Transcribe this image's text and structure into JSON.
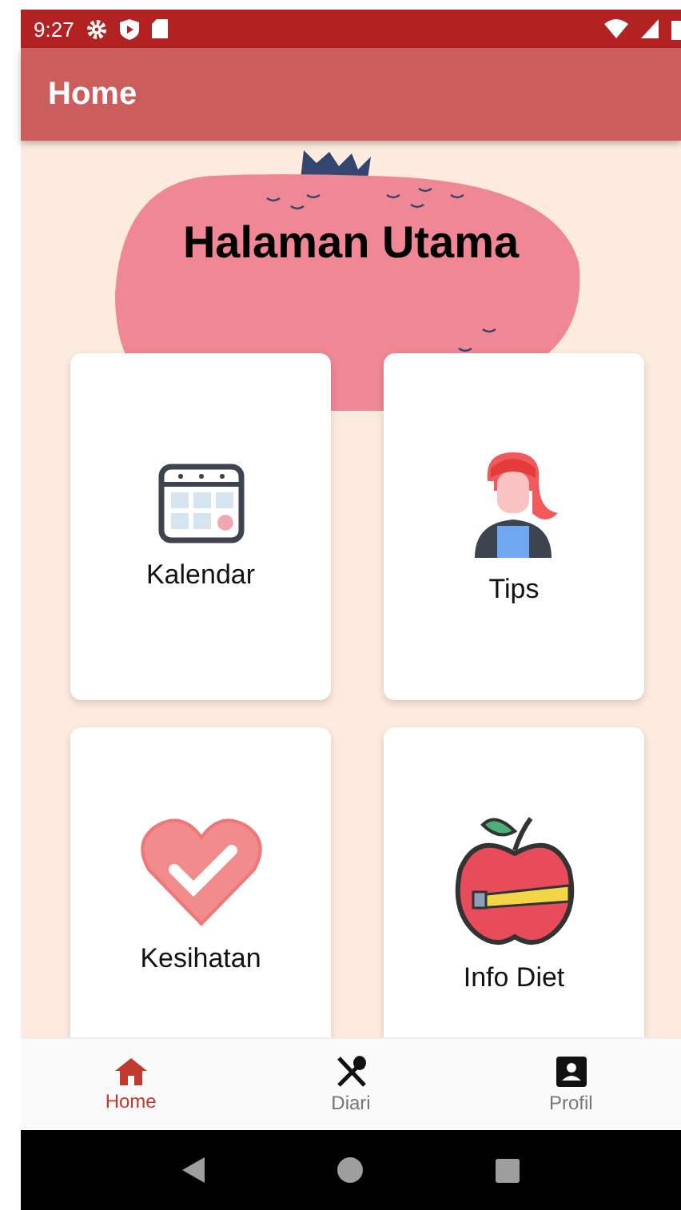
{
  "status_bar": {
    "time": "9:27"
  },
  "app_bar": {
    "title": "Home"
  },
  "header": {
    "title": "Halaman Utama"
  },
  "menu_cards": [
    {
      "kind": "calendar",
      "label": "Kalendar"
    },
    {
      "kind": "tips",
      "label": "Tips"
    },
    {
      "kind": "health",
      "label": "Kesihatan"
    },
    {
      "kind": "diet",
      "label": "Info Diet"
    }
  ],
  "bottom_nav": [
    {
      "kind": "home",
      "label": "Home",
      "selected": true
    },
    {
      "kind": "diary",
      "label": "Diari",
      "selected": false
    },
    {
      "kind": "profile",
      "label": "Profil",
      "selected": false
    }
  ]
}
